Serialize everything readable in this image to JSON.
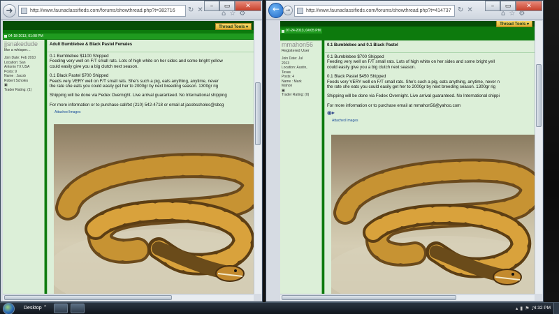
{
  "windows": [
    {
      "address": "http://www.faunaclassifieds.com/forums/showthread.php?t=382716",
      "thread_tools": "Thread Tools ▾",
      "post_date": "04-18-2013, 01:08 PM",
      "user": {
        "name": "jjsnakedude",
        "title": "like a whisper...",
        "info": [
          "Join Date: Feb 2010",
          "Location: San",
          "Antonio TX USA",
          "Posts: 9",
          "Name : Jacob",
          "Robert Scholes",
          "▣",
          "Trader Rating: (1)"
        ]
      },
      "post": {
        "title": "Adult Bumblebee & Black Pastel Females",
        "lines": [
          "0.1 Bumblebee $1100 Shipped",
          "Feeding very well on F/T small rats. Lots of high white on her sides and some bright yellow",
          "could easily give you a big clutch next season.",
          "",
          "0.1 Black Pastel $700 Shipped",
          "Feeds very VERY well on F/T small rats. She's such a pig, eats anything, anytime, never",
          "the rate she eats you could easily get her to 2000gr by next breeding season. 1300gr rig",
          "",
          "Shipping will be done via Fedex Overnight. Live arrival guaranteed. No International shipping",
          "",
          "For more information or to purchase call/txt (210) 542-4718 or email at jacobscholes@sbcg"
        ],
        "attached": "Attached Images"
      }
    },
    {
      "address": "http://www.faunaclassifieds.com/forums/showthread.php?t=414737",
      "thread_tools": "Thread Tools ▾",
      "post_date": "07-24-2013, 04:05 PM",
      "user": {
        "name": "mmahon56",
        "title": "Registered User",
        "info": [
          "Join Date: Jul",
          "2013",
          "Location: Austin,",
          "Texas",
          "Posts: 4",
          "Name : Mark",
          "Mahon",
          "▣",
          "Trader Rating: (0)"
        ]
      },
      "post": {
        "title": "0.1 Bumblebee and 0.1 Black Pastel",
        "lines": [
          "0.1 Bumblebee $700 Shipped",
          "Feeding very well on F/T small rats. Lots of high white on her sides and some bright yell",
          "could easily give you a big clutch next season.",
          "",
          "0.1 Black Pastel $450 Shipped",
          "Feeds very VERY well on F/T small rats. She's such a pig, eats anything, anytime, never n",
          "the rate she eats you could easily get her to 2000gr by next breeding season. 1300gr rig",
          "",
          "Shipping will be done via Fedex Overnight. Live arrival guaranteed. No International shippi",
          "",
          "For more information or to purchase email at mmahon56@yahoo.com"
        ],
        "attached": "Attached Images"
      }
    }
  ],
  "taskbar": {
    "desktop_label": "Desktop",
    "desktop_chevron": "»",
    "clock": "4:32 PM"
  }
}
